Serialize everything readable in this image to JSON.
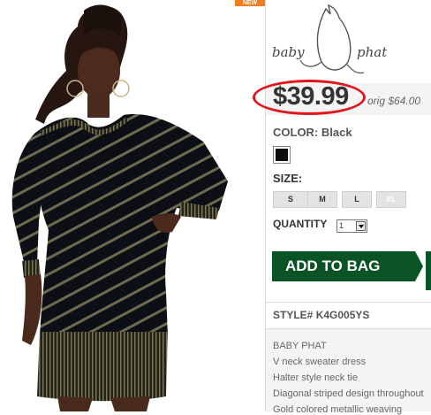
{
  "badge": {
    "text": "NEW"
  },
  "brand": {
    "logo_left": "baby",
    "logo_right": "phat"
  },
  "price": {
    "current": "$39.99",
    "original": "orig $64.00"
  },
  "color": {
    "label": "COLOR:",
    "value": "Black",
    "swatch": "#0c0c0c"
  },
  "size": {
    "label": "SIZE:",
    "options": [
      {
        "label": "S",
        "enabled": true
      },
      {
        "label": "M",
        "enabled": true
      },
      {
        "label": "L",
        "enabled": true
      },
      {
        "label": "XL",
        "enabled": false
      }
    ]
  },
  "quantity": {
    "label": "QUANTITY",
    "value": "1"
  },
  "add_to_bag": {
    "label": "ADD TO BAG"
  },
  "style": {
    "label": "STYLE#",
    "value": "K4G005YS"
  },
  "details": [
    "BABY PHAT",
    "V neck sweater dress",
    "Halter style neck tie",
    "Diagonal striped design throughout",
    "Gold colored metallic weaving"
  ]
}
